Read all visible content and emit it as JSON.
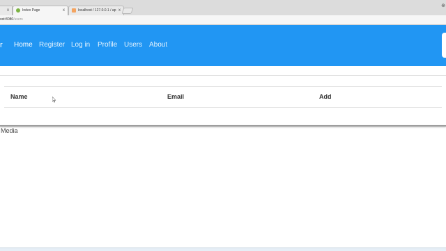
{
  "browser": {
    "tab_stub_close": "x",
    "tabs": [
      {
        "title": "Index Page",
        "close": "x",
        "icon_color": "#7cb342"
      },
      {
        "title": "localhost / 127.0.0.1 / ap",
        "close": "x",
        "icon_color": "#f4a460"
      }
    ],
    "corner_icon": "⊕",
    "address": {
      "host": "ost:8080",
      "path": "/users"
    }
  },
  "nav": {
    "background": "#2196f3",
    "items": [
      {
        "label": "Home",
        "active": true
      },
      {
        "label": "Register"
      },
      {
        "label": "Log in"
      },
      {
        "label": "Profile"
      },
      {
        "label": "Users"
      },
      {
        "label": "About"
      }
    ]
  },
  "table": {
    "headers": [
      "Name",
      "Email",
      "Add"
    ]
  },
  "media": {
    "label": "Media"
  },
  "icons": {
    "cursor": "mouse-pointer-icon",
    "brand": "brand-logo-icon",
    "new_tab": "new-tab-icon"
  }
}
